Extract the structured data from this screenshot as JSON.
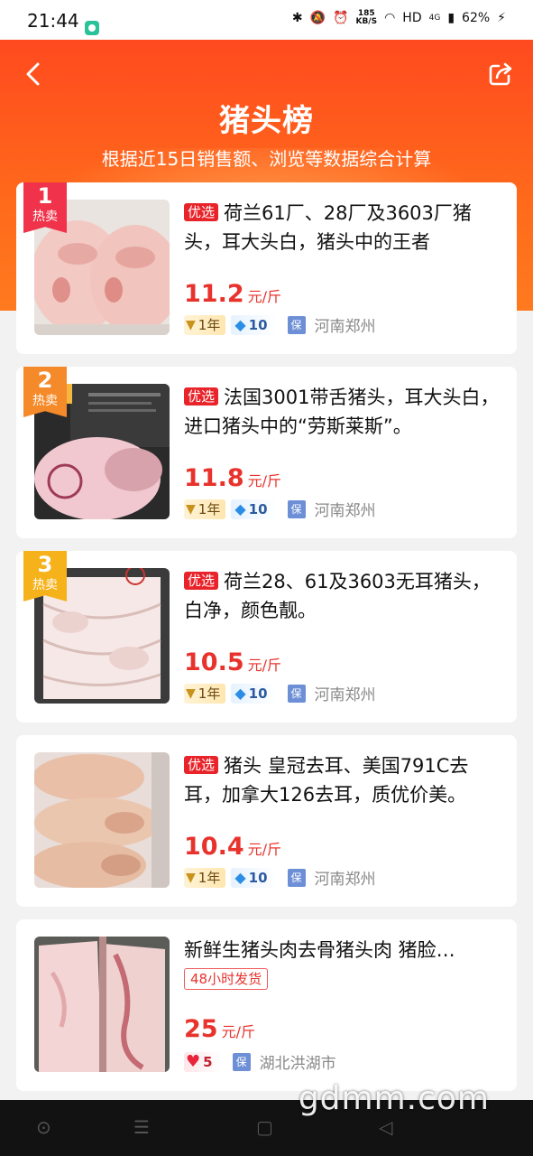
{
  "status_bar": {
    "time": "21:44",
    "net_speed_value": "185",
    "net_speed_unit": "KB/S",
    "network": "HD",
    "signal": "4G",
    "battery": "62%"
  },
  "header": {
    "title": "猪头榜",
    "subtitle": "根据近15日销售额、浏览等数据综合计算"
  },
  "products": [
    {
      "rank": "1",
      "rank_tag": "热卖",
      "selected_tag": "优选",
      "title": "荷兰61厂、28厂及3603厂猪头，耳大头白，猪头中的王者",
      "price": "11.2",
      "unit": "元/斤",
      "year_badge": "1年",
      "diamond_badge": "10",
      "guarantee": "保",
      "location": "河南郑州"
    },
    {
      "rank": "2",
      "rank_tag": "热卖",
      "selected_tag": "优选",
      "title": "法国3001带舌猪头，耳大头白，进口猪头中的“劳斯莱斯”。",
      "price": "11.8",
      "unit": "元/斤",
      "year_badge": "1年",
      "diamond_badge": "10",
      "guarantee": "保",
      "location": "河南郑州"
    },
    {
      "rank": "3",
      "rank_tag": "热卖",
      "selected_tag": "优选",
      "title": "荷兰28、61及3603无耳猪头，白净，颜色靓。",
      "price": "10.5",
      "unit": "元/斤",
      "year_badge": "1年",
      "diamond_badge": "10",
      "guarantee": "保",
      "location": "河南郑州"
    },
    {
      "selected_tag": "优选",
      "title": "猪头 皇冠去耳、美国791C去耳，加拿大126去耳，质优价美。",
      "price": "10.4",
      "unit": "元/斤",
      "year_badge": "1年",
      "diamond_badge": "10",
      "guarantee": "保",
      "location": "河南郑州"
    },
    {
      "title": "新鲜生猪头肉去骨猪头肉 猪脸…",
      "ship_tag": "48小时发货",
      "price": "25",
      "unit": "元/斤",
      "heart_badge": "5",
      "guarantee": "保",
      "location": "湖北洪湖市"
    }
  ],
  "watermark": "gdmm.com",
  "colors": {
    "header_orange": "#ff5a1d",
    "price_red": "#e8332d",
    "rank1": "#f0324a",
    "rank2": "#f58a2a",
    "rank3": "#f6b21a"
  },
  "icons": [
    "back-arrow-icon",
    "share-icon",
    "diamond-icon",
    "heart-icon",
    "v-badge-icon"
  ]
}
